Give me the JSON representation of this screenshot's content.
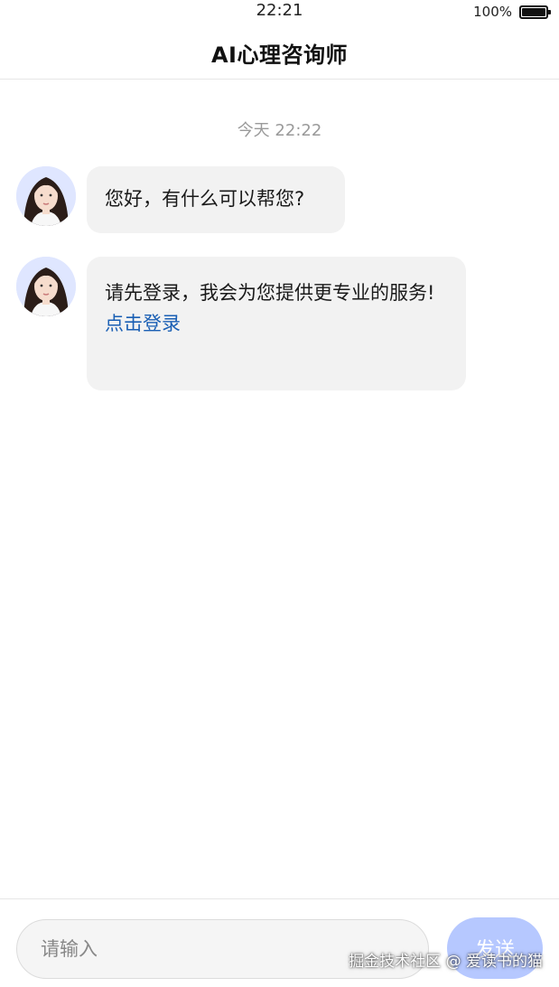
{
  "status_bar": {
    "time": "22:21",
    "battery_pct": "100%",
    "battery_level": 1.0
  },
  "header": {
    "title": "AI心理咨询师"
  },
  "chat": {
    "timestamp": "今天 22:22",
    "messages": [
      {
        "text": "您好，有什么可以帮您?",
        "avatar": "assistant-avatar"
      },
      {
        "text": "请先登录，我会为您提供更专业的服务!",
        "link": "点击登录",
        "avatar": "assistant-avatar"
      }
    ]
  },
  "input": {
    "placeholder": "请输入",
    "value": "",
    "send_label": "发送"
  },
  "watermark": "掘金技术社区 @ 爱读书的猫",
  "colors": {
    "accent": "#b6c8ff",
    "link": "#1a5fb4",
    "bubble": "#f2f2f2",
    "avatar_bg": "#dfe6ff"
  }
}
